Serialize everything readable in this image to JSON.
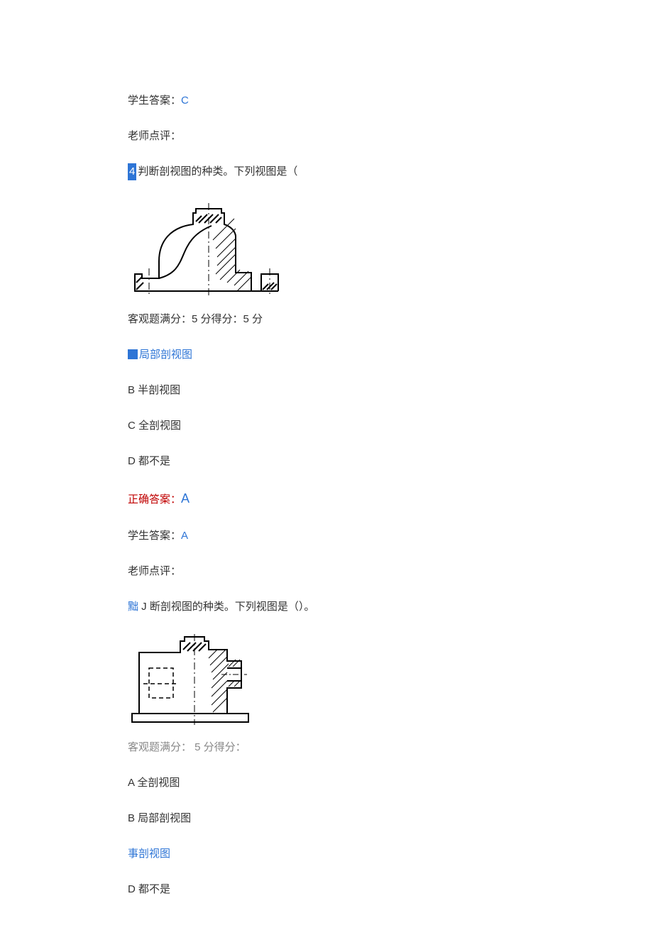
{
  "q3": {
    "student_answer_label": "学生答案：",
    "student_answer_value": "C",
    "teacher_comment_label": "老师点评："
  },
  "q4": {
    "number": "4",
    "prompt": "判断剖视图的种类。下列视图是（",
    "score_line": "客观题满分：5 分得分：5 分",
    "option_a": "局部剖视图",
    "option_b": "B 半剖视图",
    "option_c": "C 全剖视图",
    "option_d": "D 都不是",
    "correct_label": "正确答案：",
    "correct_value": "A",
    "student_answer_label": "学生答案：",
    "student_answer_value": "A",
    "teacher_comment_label": "老师点评："
  },
  "q5": {
    "prefix": "黜",
    "prompt": " J 断剖视图的种类。下列视图是（）。",
    "score_line": "客观题满分： 5 分得分：",
    "option_a": "A 全剖视图",
    "option_b": "B 局部剖视图",
    "option_c": "事剖视图",
    "option_d": "D 都不是"
  }
}
